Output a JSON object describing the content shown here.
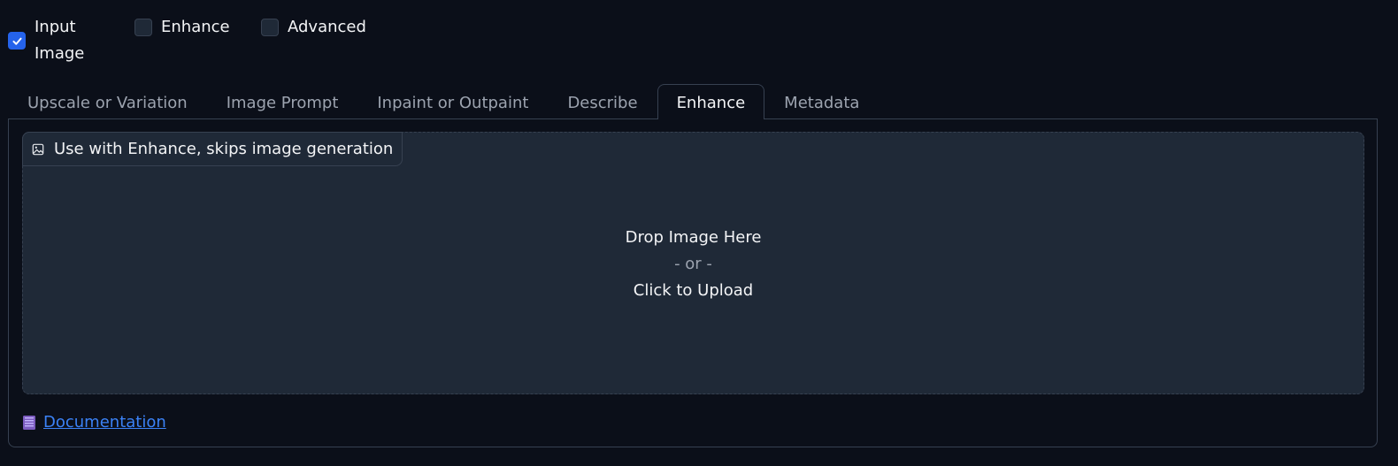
{
  "checkboxes": {
    "input_image": {
      "label": "Input Image",
      "checked": true
    },
    "enhance": {
      "label": "Enhance",
      "checked": false
    },
    "advanced": {
      "label": "Advanced",
      "checked": false
    }
  },
  "tabs": [
    {
      "label": "Upscale or Variation",
      "active": false
    },
    {
      "label": "Image Prompt",
      "active": false
    },
    {
      "label": "Inpaint or Outpaint",
      "active": false
    },
    {
      "label": "Describe",
      "active": false
    },
    {
      "label": "Enhance",
      "active": true
    },
    {
      "label": "Metadata",
      "active": false
    }
  ],
  "dropzone": {
    "label": "Use with Enhance, skips image generation",
    "label_icon": "image-icon",
    "drop_text": "Drop Image Here",
    "or_text": "- or -",
    "upload_text": "Click to Upload"
  },
  "documentation": {
    "icon": "book-icon",
    "label": "Documentation"
  },
  "colors": {
    "background": "#0b0f19",
    "panel": "#1f2937",
    "border": "#374151",
    "accent": "#2563eb",
    "link": "#3b82f6"
  }
}
